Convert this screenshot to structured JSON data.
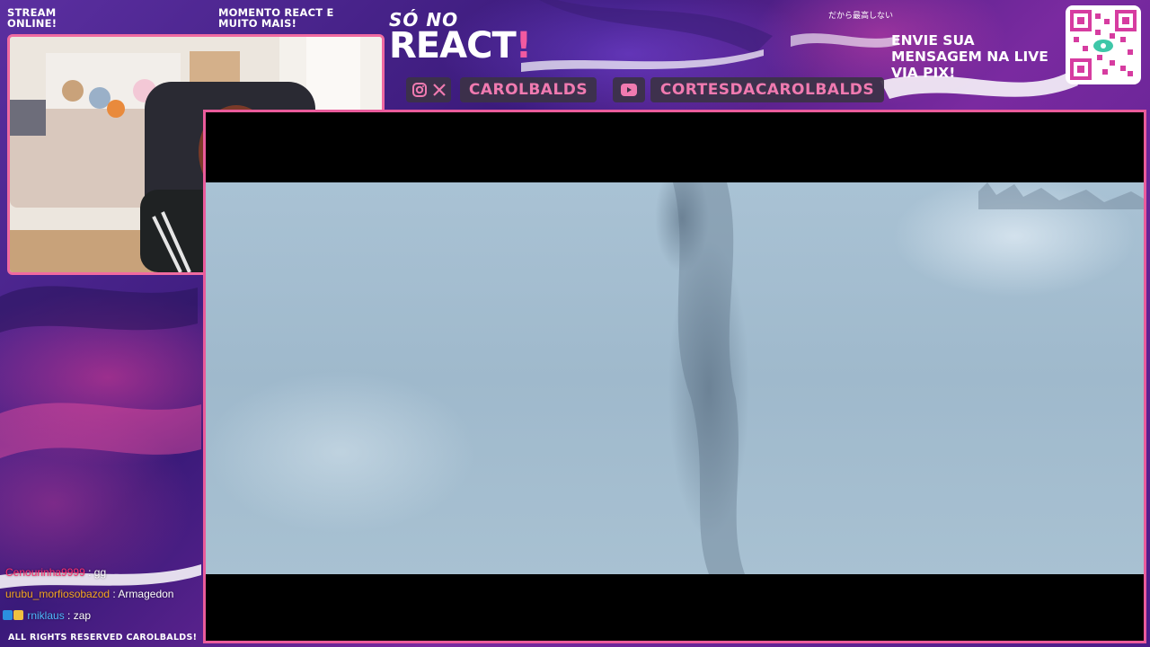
{
  "overlay": {
    "status_text": "STREAM ONLINE!",
    "react_promo_text": "MOMENTO REACT E MUITO MAIS!",
    "logo_top": "SÓ NO",
    "logo_main": "REACT",
    "logo_bang": "!",
    "jp_text": "だから最高しない",
    "pix_text": "ENVIE SUA MENSAGEM NA LIVE VIA PIX!",
    "footer_text": "ALL RIGHTS RESERVED CAROLBALDS!"
  },
  "socials": {
    "handle": "CAROLBALDS",
    "youtube_channel": "CORTESDACAROLBALDS",
    "icons": [
      "instagram-icon",
      "x-icon",
      "youtube-icon"
    ]
  },
  "chat": {
    "messages": [
      {
        "user": "Cenourinha9999",
        "text": "gg",
        "user_color": "#ff2d6f"
      },
      {
        "user": "urubu_morfiosobazod",
        "text": "Armagedon",
        "user_color": "#f5a623"
      },
      {
        "user": "rniklaus",
        "text": "zap",
        "user_color": "#4fb8ff",
        "badges": [
          "prime-badge-icon",
          "sub-badge-icon"
        ]
      }
    ]
  },
  "colors": {
    "accent_pink": "#ea5b9b",
    "pill_text": "#f07ab0",
    "background_purple": "#3a1a6e"
  }
}
